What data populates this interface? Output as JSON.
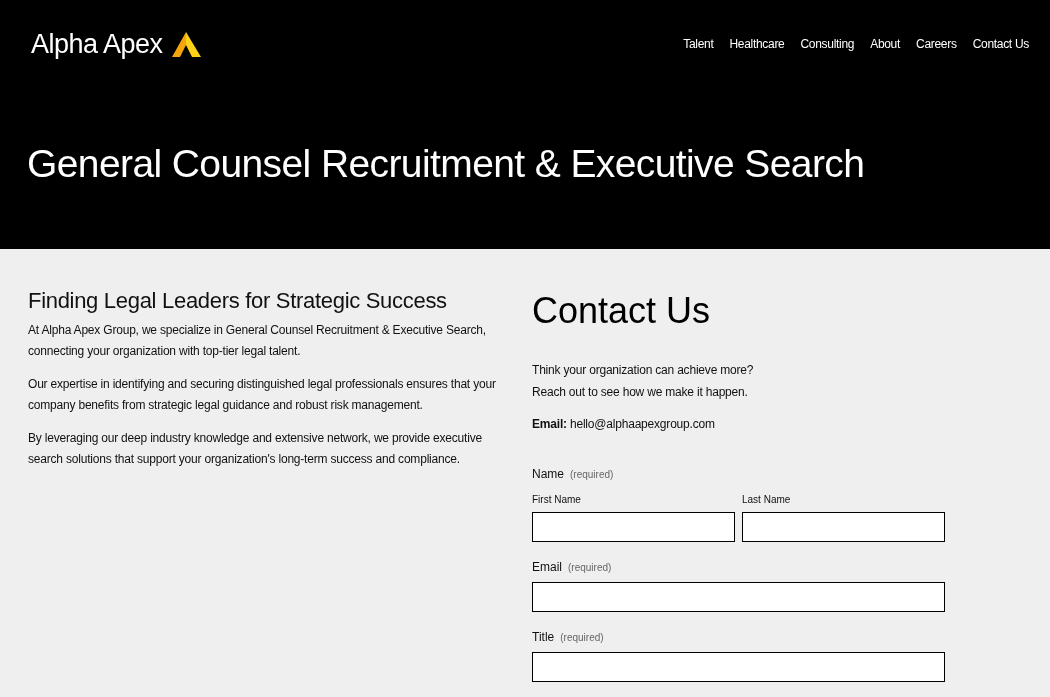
{
  "header": {
    "logo": {
      "text": "Alpha Apex"
    },
    "nav": [
      {
        "label": "Talent"
      },
      {
        "label": "Healthcare"
      },
      {
        "label": "Consulting"
      },
      {
        "label": "About"
      },
      {
        "label": "Careers"
      },
      {
        "label": "Contact Us"
      }
    ]
  },
  "hero": {
    "title": "General Counsel Recruitment & Executive Search"
  },
  "intro": {
    "heading": "Finding Legal Leaders for Strategic Success",
    "paragraphs": [
      "At Alpha Apex Group, we specialize in General Counsel Recruitment & Executive Search, connecting your organization with top-tier legal talent.",
      "Our expertise in identifying and securing distinguished legal professionals ensures that your company benefits from strategic legal guidance and robust risk management.",
      "By leveraging our deep industry knowledge and extensive network, we provide executive search solutions that support your organization's long-term success and compliance."
    ]
  },
  "contact": {
    "title": "Contact Us",
    "lines": [
      "Think your organization can achieve more?",
      "Reach out to see how we make it happen."
    ],
    "email_line": "**Email:** hello@alphaapexgroup.com",
    "form": {
      "fields": [
        {
          "kind": "name",
          "label": "Name",
          "note": "(required)",
          "parts": [
            {
              "label": "First Name"
            },
            {
              "label": "Last Name"
            }
          ]
        },
        {
          "kind": "text",
          "label": "Email",
          "note": "(required)"
        },
        {
          "kind": "text",
          "label": "Title",
          "note": "(required)"
        }
      ]
    }
  }
}
